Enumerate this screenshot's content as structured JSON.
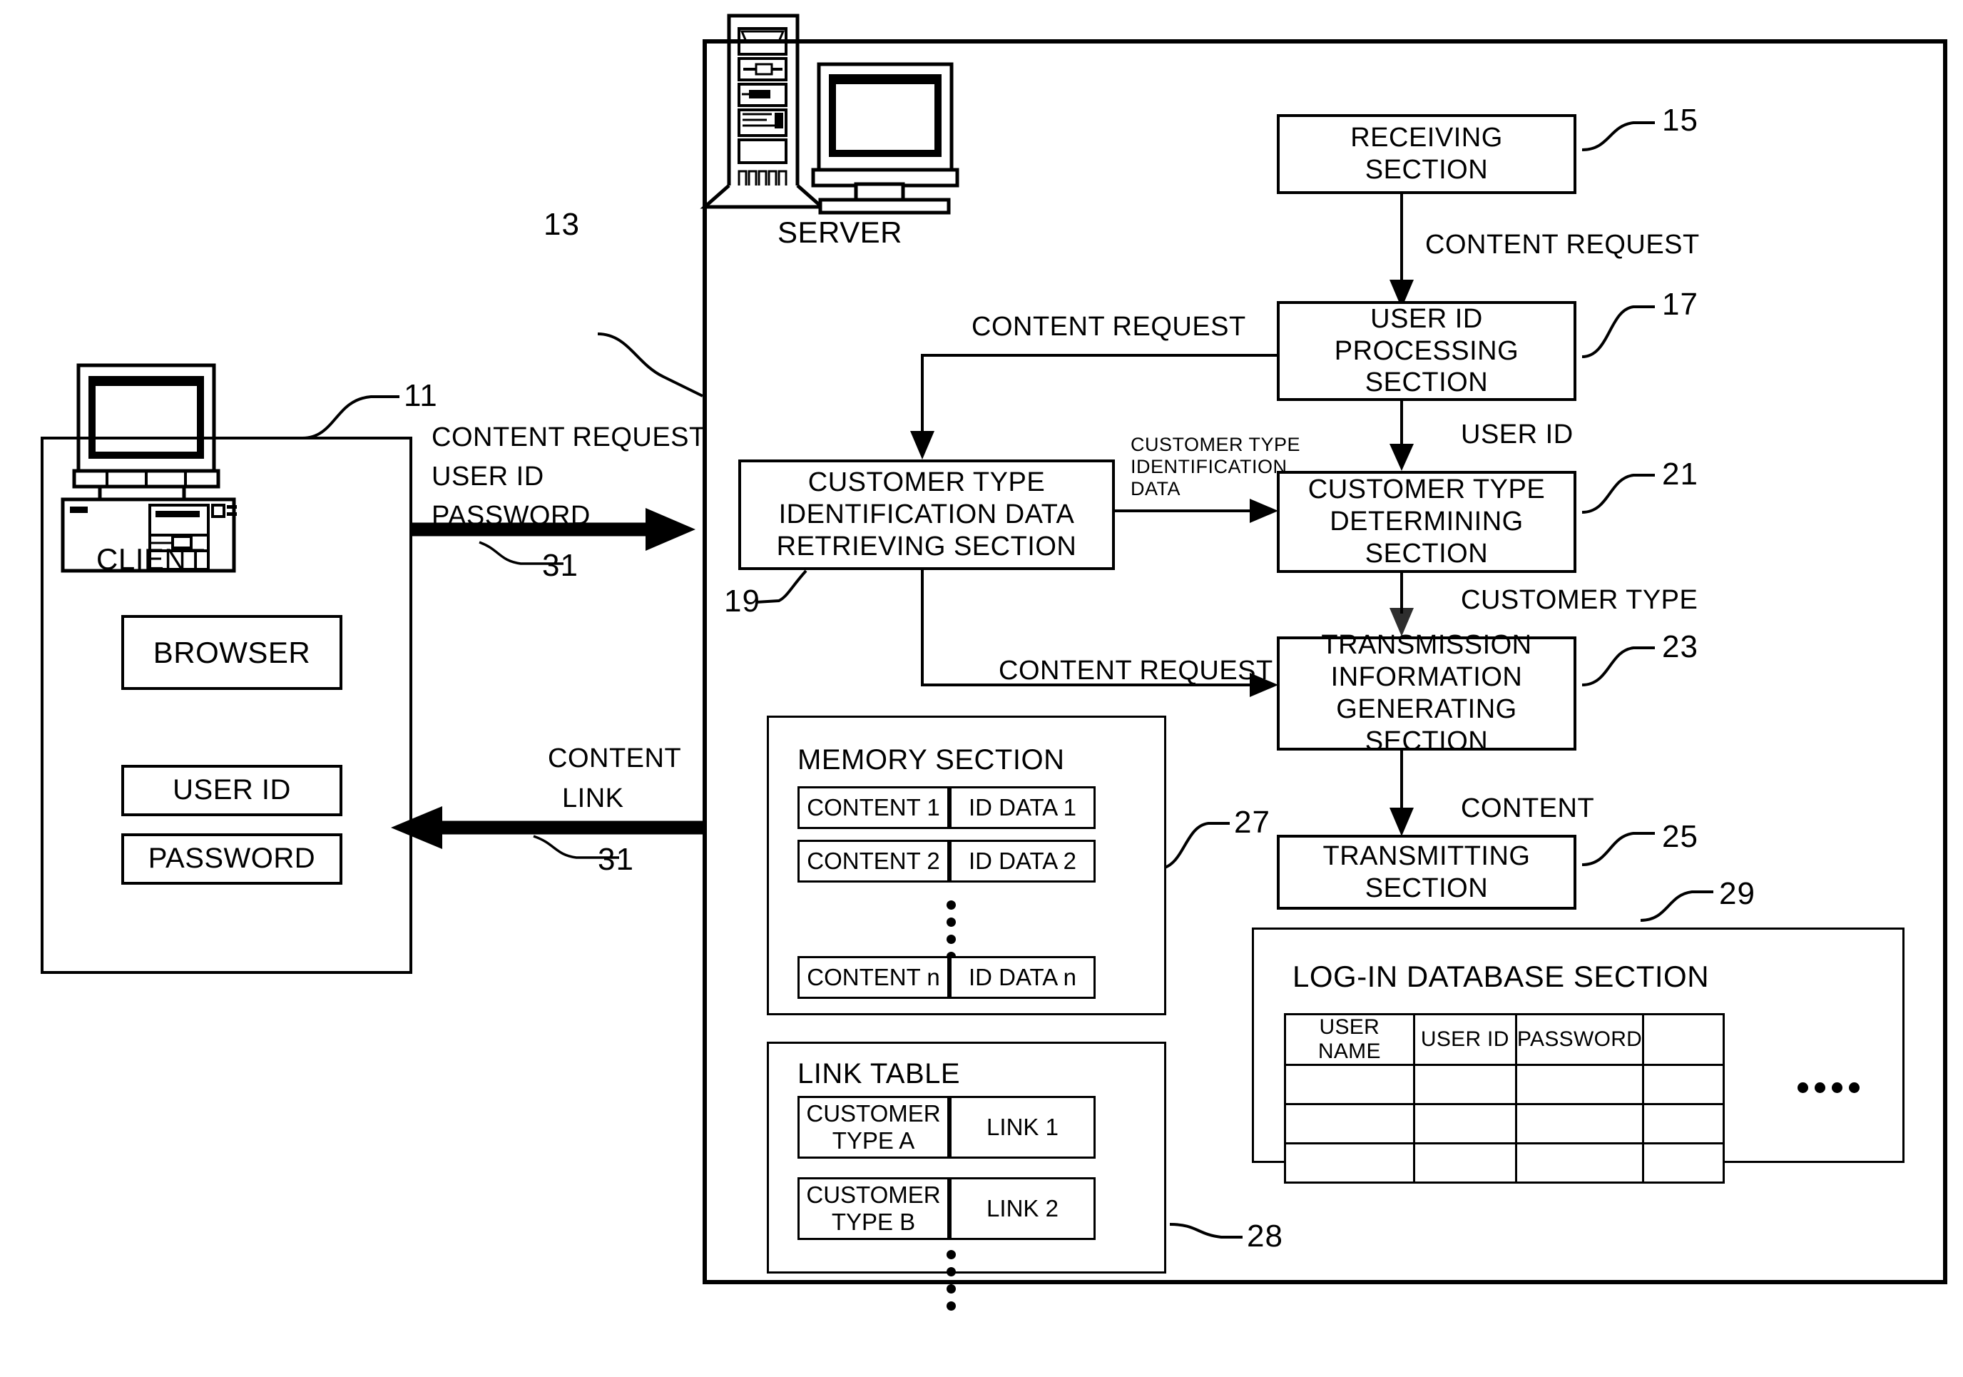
{
  "figure": {
    "client": {
      "label": "CLIENT",
      "ref": "11",
      "browser": "BROWSER",
      "user_id": "USER ID",
      "password": "PASSWORD"
    },
    "server": {
      "label": "SERVER",
      "ref": "13"
    },
    "links": {
      "request_line1": "CONTENT REQUEST",
      "request_line2": "USER ID",
      "request_line3": "PASSWORD",
      "request_ref": "31",
      "response_line1": "CONTENT",
      "response_line2": "LINK",
      "response_ref": "31"
    },
    "blocks": [
      {
        "id": "receiving",
        "text": "RECEIVING\nSECTION",
        "ref": "15"
      },
      {
        "id": "user-id-proc",
        "text": "USER ID\nPROCESSING\nSECTION",
        "ref": "17"
      },
      {
        "id": "ct-retrieving",
        "text": "CUSTOMER TYPE\nIDENTIFICATION DATA\nRETRIEVING SECTION",
        "ref": "19"
      },
      {
        "id": "ct-determining",
        "text": "CUSTOMER TYPE\nDETERMINING\nSECTION",
        "ref": "21"
      },
      {
        "id": "tx-info-gen",
        "text": "TRANSMISSION\nINFORMATION\nGENERATING\nSECTION",
        "ref": "23"
      },
      {
        "id": "transmitting",
        "text": "TRANSMITTING\nSECTION",
        "ref": "25"
      }
    ],
    "flow_labels": {
      "receiving_to_userid": "CONTENT REQUEST",
      "userid_to_retrieving": "CONTENT REQUEST",
      "userid_to_determining": "USER ID",
      "retrieving_to_determining": "CUSTOMER TYPE\nIDENTIFICATION\nDATA",
      "determining_to_generating": "CUSTOMER TYPE",
      "retrieving_to_generating": "CONTENT REQUEST",
      "generating_to_transmitting": "CONTENT"
    },
    "memory_section": {
      "title": "MEMORY SECTION",
      "ref": "27",
      "rows": [
        {
          "content": "CONTENT 1",
          "iddata": "ID DATA 1"
        },
        {
          "content": "CONTENT 2",
          "iddata": "ID DATA 2"
        },
        {
          "content": "CONTENT n",
          "iddata": "ID DATA n"
        }
      ]
    },
    "link_table": {
      "title": "LINK TABLE",
      "ref": "28",
      "rows": [
        {
          "type": "CUSTOMER\nTYPE A",
          "link": "LINK 1"
        },
        {
          "type": "CUSTOMER\nTYPE B",
          "link": "LINK 2"
        }
      ]
    },
    "login_db": {
      "title": "LOG-IN DATABASE SECTION",
      "ref": "29",
      "headers": [
        "USER NAME",
        "USER ID",
        "PASSWORD",
        ""
      ],
      "rows": [
        [
          "",
          "",
          "",
          ""
        ],
        [
          "",
          "",
          "",
          ""
        ],
        [
          "",
          "",
          "",
          ""
        ]
      ]
    }
  }
}
